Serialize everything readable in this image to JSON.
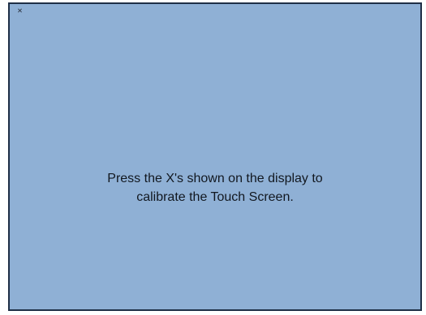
{
  "calibration": {
    "target_symbol": "x",
    "instruction_line_1": "Press the X's shown on the display to",
    "instruction_line_2": "calibrate the Touch Screen.",
    "background_color": "#8fb0d5",
    "border_color": "#1f2f46",
    "text_color": "#121820"
  }
}
